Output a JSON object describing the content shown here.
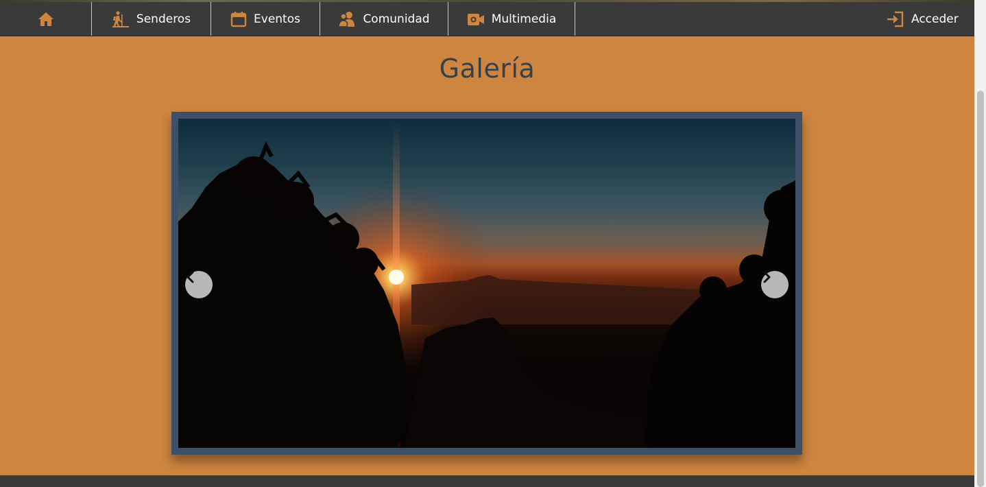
{
  "nav": {
    "home_icon": "home-icon",
    "items": [
      {
        "label": "Senderos",
        "icon": "hiker-icon"
      },
      {
        "label": "Eventos",
        "icon": "calendar-icon"
      },
      {
        "label": "Comunidad",
        "icon": "users-icon"
      },
      {
        "label": "Multimedia",
        "icon": "camera-icon"
      }
    ],
    "login": {
      "label": "Acceder",
      "icon": "sign-in-icon"
    }
  },
  "page": {
    "title": "Galería"
  },
  "gallery": {
    "prev_icon": "chevron-left-icon",
    "next_icon": "chevron-right-icon",
    "image_subject": "sunset-over-mountains"
  },
  "colors": {
    "background": "#cd853f",
    "navbar": "#3a3a3a",
    "accent_icon": "#cd853f",
    "title": "#36404a",
    "frame": "#3e4f6a"
  }
}
